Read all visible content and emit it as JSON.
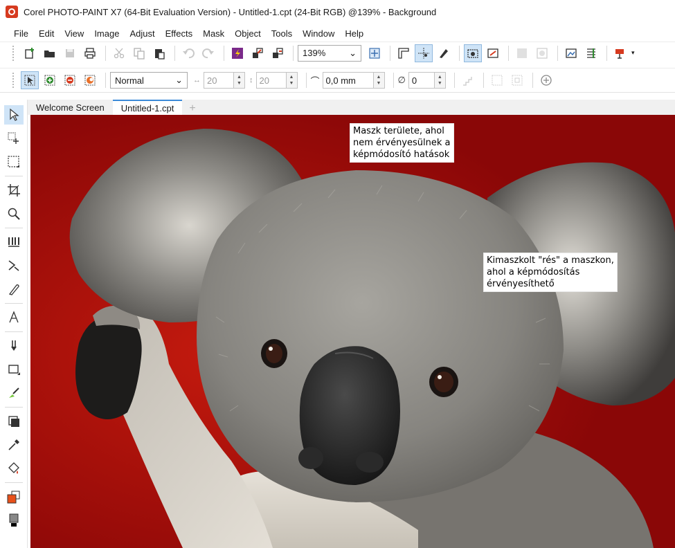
{
  "window": {
    "title": "Corel PHOTO-PAINT X7 (64-Bit Evaluation Version) - Untitled-1.cpt (24-Bit RGB) @139% - Background"
  },
  "menu": [
    "File",
    "Edit",
    "View",
    "Image",
    "Adjust",
    "Effects",
    "Mask",
    "Object",
    "Tools",
    "Window",
    "Help"
  ],
  "toolbar": {
    "zoom_value": "139%"
  },
  "property_bar": {
    "merge_mode": "Normal",
    "width_value": "20",
    "height_value": "20",
    "feather_value": "0,0 mm",
    "transparency_value": "0"
  },
  "tabs": [
    "Welcome Screen",
    "Untitled-1.cpt"
  ],
  "canvas": {
    "callout_mask": [
      "Maszk területe, ahol",
      "nem érvényesülnek a",
      "képmódosító hatások"
    ],
    "callout_gap": [
      "Kimaszkolt \"rés\" a maszkon,",
      "ahol a képmódosítás",
      "érvényesíthető"
    ]
  },
  "colors": {
    "mask_overlay": "#9a0808",
    "accent": "#d63a1f",
    "tab_accent": "#3b8ad8"
  }
}
